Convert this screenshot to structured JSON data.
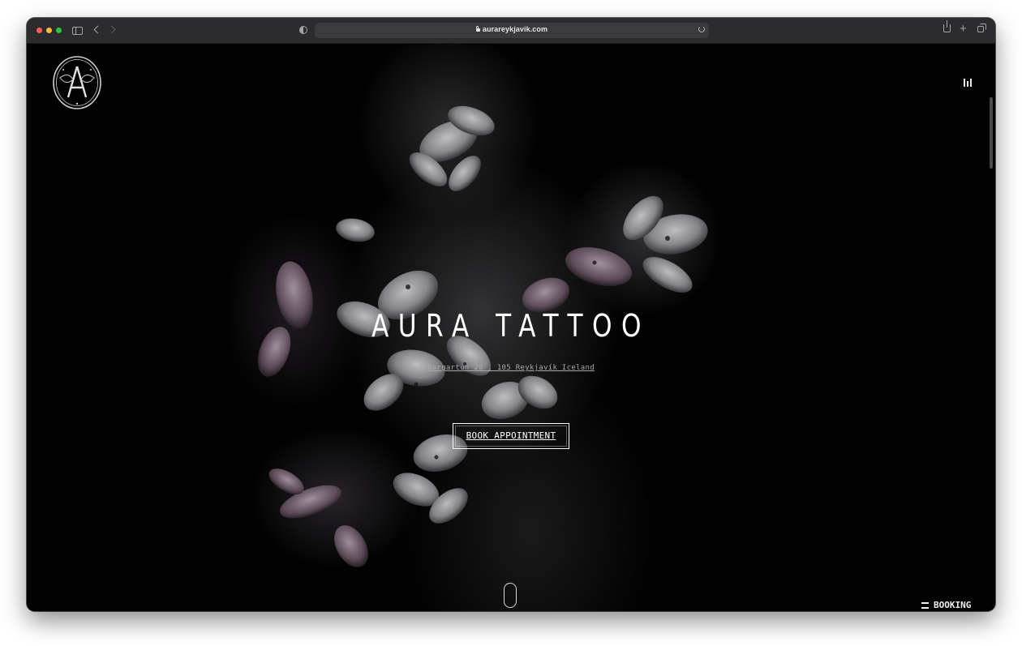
{
  "browser": {
    "url": "aurareykjavik.com"
  },
  "hero": {
    "title": "AURA TATTOO",
    "address": "Borgartún 28 , 105 Reykjavík Iceland",
    "cta_label": "BOOK APPOINTMENT"
  },
  "floating": {
    "booking_label": "BOOKING"
  },
  "colors": {
    "page_background": "#020202",
    "text": "#ffffff",
    "address_text": "#a9a9a9"
  },
  "icons": {
    "logo": "aura-moth-emblem",
    "menu": "menu-bars-icon",
    "scroll": "scroll-mouse-icon",
    "booking": "hamburger-icon"
  }
}
